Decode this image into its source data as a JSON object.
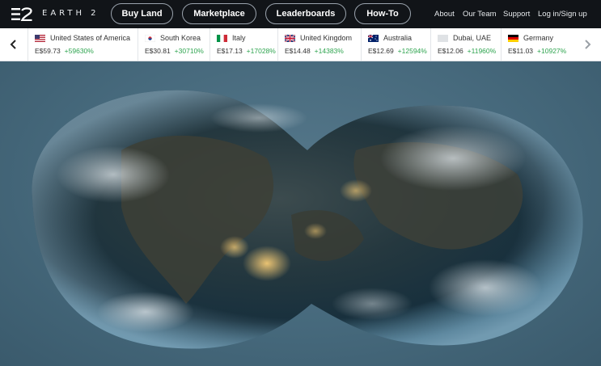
{
  "brand": {
    "wordmark": "EARTH 2"
  },
  "nav": {
    "pills": [
      "Buy Land",
      "Marketplace",
      "Leaderboards",
      "How-To"
    ],
    "links": [
      "About",
      "Our Team",
      "Support",
      "Log in/Sign up"
    ]
  },
  "ticker": {
    "items": [
      {
        "country": "United States of America",
        "price": "E$59.73",
        "change": "+59630%",
        "flag": "us-flag"
      },
      {
        "country": "South Korea",
        "price": "E$30.81",
        "change": "+30710%",
        "flag": "kr-flag"
      },
      {
        "country": "Italy",
        "price": "E$17.13",
        "change": "+17028%",
        "flag": "it-flag"
      },
      {
        "country": "United Kingdom",
        "price": "E$14.48",
        "change": "+14383%",
        "flag": "uk-flag"
      },
      {
        "country": "Australia",
        "price": "E$12.69",
        "change": "+12594%",
        "flag": "au-flag"
      },
      {
        "country": "Dubai, UAE",
        "price": "E$12.06",
        "change": "+11960%",
        "flag": "blank-flag"
      },
      {
        "country": "Germany",
        "price": "E$11.03",
        "change": "+10927%",
        "flag": "de-flag"
      }
    ]
  },
  "colors": {
    "topbar": "#111418",
    "positive": "#2ea44f",
    "background": "#4a6b7e"
  }
}
